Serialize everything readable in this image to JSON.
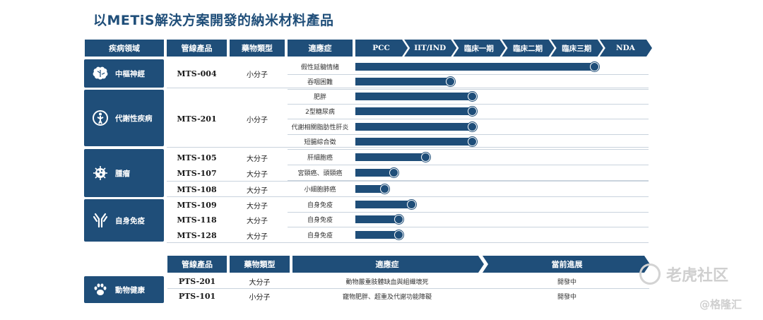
{
  "title": "以METiS解決方案開發的納米材料產品",
  "headers": {
    "area": "疾病領域",
    "product": "管線產品",
    "type": "藥物類型",
    "indication": "適應症",
    "stages": [
      "PCC",
      "IIT/IND",
      "臨床一期",
      "臨床二期",
      "臨床三期",
      "NDA"
    ]
  },
  "areas": [
    {
      "label": "中樞神經",
      "icon": "brain-icon"
    },
    {
      "label": "代謝性疾病",
      "icon": "metabolism-icon"
    },
    {
      "label": "腫瘤",
      "icon": "tumor-cell-icon"
    },
    {
      "label": "自身免疫",
      "icon": "antibody-icon"
    }
  ],
  "products": [
    {
      "name": "MTS-004",
      "type": "小分子"
    },
    {
      "name": "MTS-201",
      "type": "小分子"
    },
    {
      "name": "MTS-105",
      "type": "大分子"
    },
    {
      "name": "MTS-107",
      "type": "大分子"
    },
    {
      "name": "MTS-108",
      "type": "大分子"
    },
    {
      "name": "MTS-109",
      "type": "大分子"
    },
    {
      "name": "MTS-118",
      "type": "大分子"
    },
    {
      "name": "MTS-128",
      "type": "大分子"
    }
  ],
  "chart_data": {
    "type": "bar",
    "orientation": "horizontal",
    "scale": "development stage",
    "categories": [
      "假性延髓情緒",
      "吞咽困難",
      "肥胖",
      "2型糖尿病",
      "代謝相關脂肪性肝炎",
      "短腸綜合徵",
      "肝細胞癌",
      "宮頸癌、頭頸癌",
      "小細胞肺癌",
      "自身免疫",
      "自身免疫",
      "自身免疫"
    ],
    "values": [
      4.9,
      1.95,
      2.4,
      2.4,
      2.4,
      2.4,
      1.45,
      0.8,
      0.6,
      1.15,
      0.9,
      0.9
    ],
    "xlim": [
      0,
      6
    ],
    "stage_labels": [
      "PCC",
      "IIT/IND",
      "臨床一期",
      "臨床二期",
      "臨床三期",
      "NDA"
    ]
  },
  "animal": {
    "area": {
      "label": "動物健康",
      "icon": "paw-icon"
    },
    "headers": {
      "product": "管線產品",
      "type": "藥物類型",
      "indication": "適應症",
      "status": "當前進展"
    },
    "rows": [
      {
        "name": "PTS-201",
        "type": "大分子",
        "indication": "動物嚴重肢體缺血與組織壞死",
        "status": "開發中"
      },
      {
        "name": "PTS-101",
        "type": "小分子",
        "indication": "寵物肥胖、超重及代謝功能障礙",
        "status": "開發中"
      }
    ]
  },
  "watermark": {
    "brand": "老虎社区",
    "credit": "@格隆汇"
  }
}
